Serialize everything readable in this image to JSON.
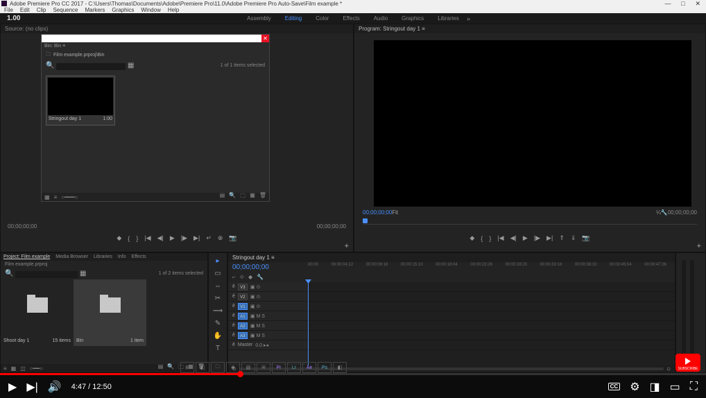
{
  "window": {
    "title": "Adobe Premiere Pro CC 2017 - C:\\Users\\Thomas\\Documents\\Adobe\\Premiere Pro\\11.0\\Adobe Premiere Pro Auto-Save\\Film example *",
    "min": "—",
    "max": "□",
    "close": "✕"
  },
  "menu": [
    "File",
    "Edit",
    "Clip",
    "Sequence",
    "Markers",
    "Graphics",
    "Window",
    "Help"
  ],
  "logo": "1.00",
  "workspaces": [
    "Assembly",
    "Editing",
    "Color",
    "Effects",
    "Audio",
    "Graphics",
    "Libraries"
  ],
  "active_workspace": "Editing",
  "source": {
    "header": "Source: (no clips)",
    "tc_left": "00;00;00;00",
    "tc_right": "00;00;00;00"
  },
  "bin": {
    "sub": "Bin: Bin ≡",
    "crumb": "Film example.prproj\\Bin",
    "info": "1 of 1 items selected",
    "thumb_label": "Stringout day 1",
    "thumb_dur": "1:00"
  },
  "program": {
    "header": "Program: Stringout day 1 ≡",
    "tc_left": "00;00;00;00",
    "fit": "Fit",
    "scale": "¼",
    "tc_right": "00;00;00;00"
  },
  "project": {
    "tabs": [
      "Project: Film example",
      "Media Browser",
      "Libraries",
      "Info",
      "Effects"
    ],
    "sub": "Film example.prproj",
    "count": "1 of 2 items selected",
    "items": [
      {
        "name": "Shoot day 1",
        "meta": "15 items"
      },
      {
        "name": "Bin",
        "meta": "1 item"
      }
    ]
  },
  "tools": [
    "▸",
    "▭",
    "⇔",
    "✂",
    "⟿",
    "✎",
    "✋",
    "T"
  ],
  "timeline": {
    "header": "Stringout day 1 ≡",
    "tc": "00;00;00;00",
    "ruler": [
      "00:00",
      "00:00:04:22",
      "00:00:09:16",
      "00:00:15:10",
      "00:00:18:04",
      "00:00:23:26",
      "00:00:28:20",
      "00:00:33:16",
      "00:00:38:10",
      "00:00:45:04",
      "00:00:47:26"
    ],
    "tracks_v": [
      "V3",
      "V2",
      "V1"
    ],
    "tracks_a": [
      "A1",
      "A2",
      "A3"
    ],
    "master": "Master"
  },
  "player": {
    "time": "4:47 / 12:50",
    "cc": "CC"
  },
  "icons": {
    "play": "▶",
    "next": "▶|",
    "vol": "🔊",
    "gear": "⚙",
    "mini": "◨",
    "theater": "▭",
    "full": "⛶",
    "folder": "🗀",
    "search": "🔍",
    "new": "▦",
    "trash": "🗑"
  }
}
